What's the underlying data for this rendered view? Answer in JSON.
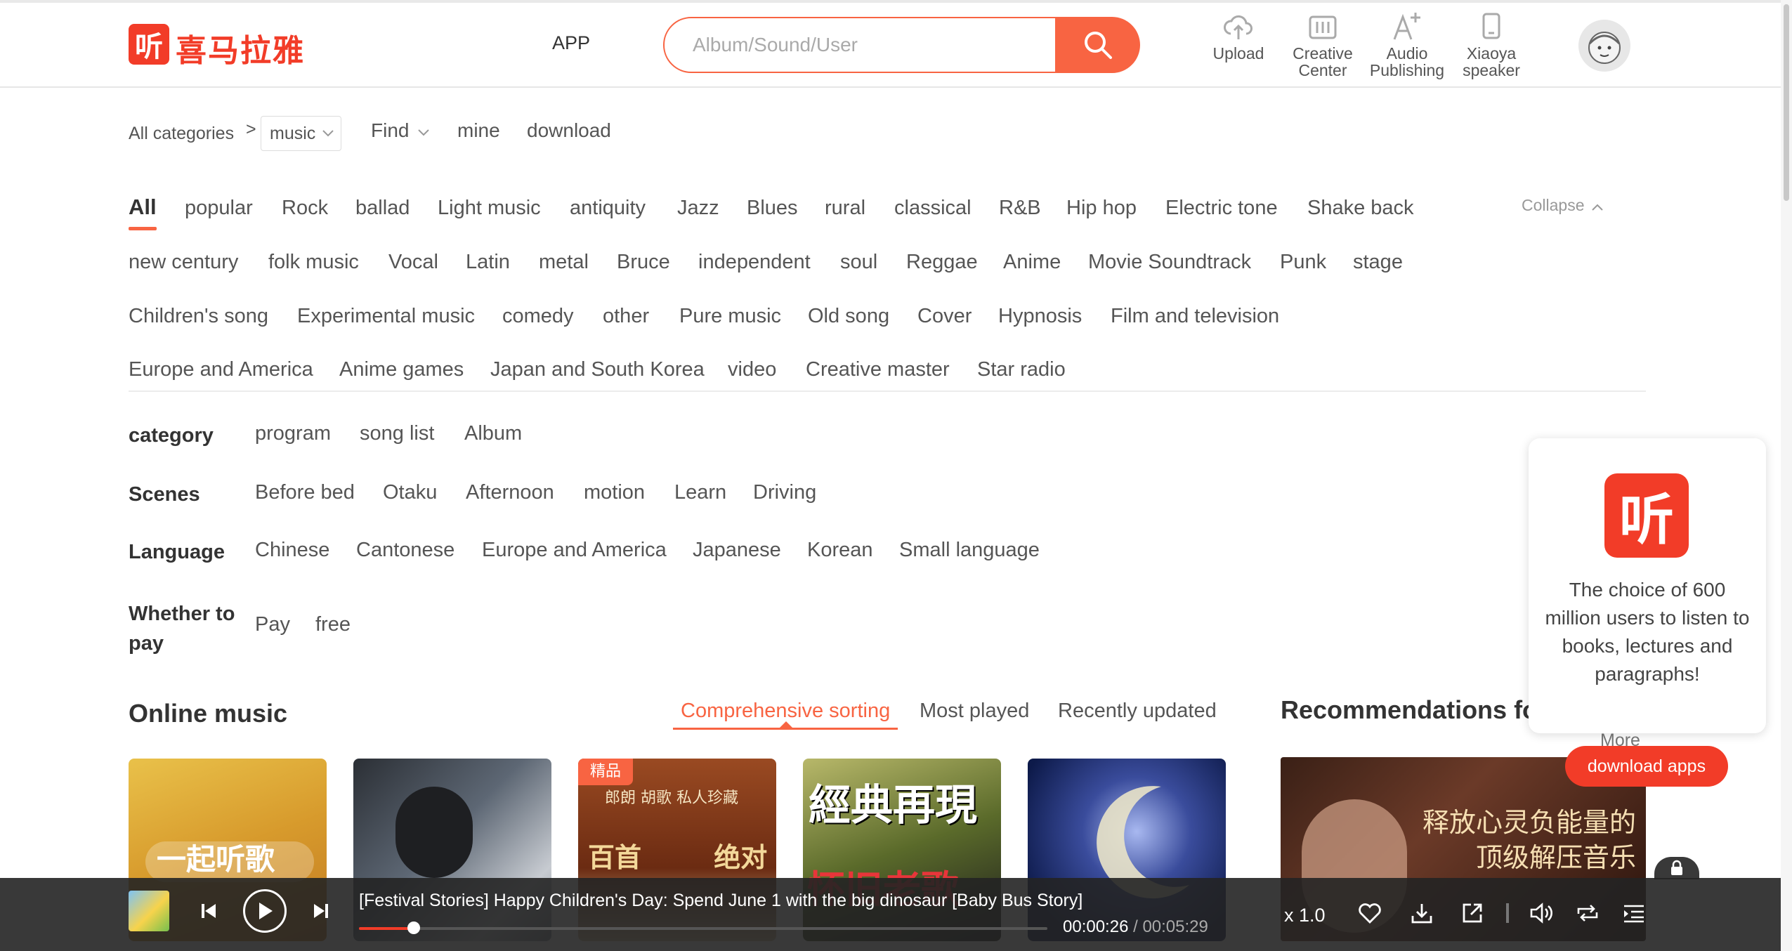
{
  "header": {
    "logo_glyph": "听",
    "logo_text": "喜马拉雅",
    "app_link": "APP",
    "search_placeholder": "Album/Sound/User",
    "tools": [
      {
        "label": "Upload",
        "icon": "cloud-upload-icon"
      },
      {
        "label": "Creative Center",
        "icon": "sliders-icon"
      },
      {
        "label": "Audio Publishing",
        "icon": "text-add-icon"
      },
      {
        "label": "Xiaoya speaker",
        "icon": "speaker-device-icon"
      }
    ]
  },
  "breadcrumb": {
    "root": "All categories",
    "separator": ">",
    "selected": "music",
    "nav": [
      "Find",
      "mine",
      "download"
    ]
  },
  "genres": {
    "row1": [
      "All",
      "popular",
      "Rock",
      "ballad",
      "Light music",
      "antiquity",
      "Jazz",
      "Blues",
      "rural",
      "classical",
      "R&B",
      "Hip hop",
      "Electric tone",
      "Shake back"
    ],
    "row2": [
      "new century",
      "folk music",
      "Vocal",
      "Latin",
      "metal",
      "Bruce",
      "independent",
      "soul",
      "Reggae",
      "Anime",
      "Movie Soundtrack",
      "Punk",
      "stage"
    ],
    "row3": [
      "Children's song",
      "Experimental music",
      "comedy",
      "other",
      "Pure music",
      "Old song",
      "Cover",
      "Hypnosis",
      "Film and television"
    ],
    "row4": [
      "Europe and America",
      "Anime games",
      "Japan and South Korea",
      "video",
      "Creative master",
      "Star radio"
    ],
    "collapse": "Collapse"
  },
  "filters": {
    "category": {
      "label": "category",
      "options": [
        "program",
        "song list",
        "Album"
      ]
    },
    "scenes": {
      "label": "Scenes",
      "options": [
        "Before bed",
        "Otaku",
        "Afternoon",
        "motion",
        "Learn",
        "Driving"
      ]
    },
    "language": {
      "label": "Language",
      "options": [
        "Chinese",
        "Cantonese",
        "Europe and America",
        "Japanese",
        "Korean",
        "Small language"
      ]
    },
    "pay": {
      "label_line1": "Whether to",
      "label_line2": "pay",
      "options": [
        "Pay",
        "free"
      ]
    }
  },
  "online_music": {
    "title": "Online music",
    "sort_tabs": [
      "Comprehensive sorting",
      "Most played",
      "Recently updated"
    ],
    "cards": [
      {
        "cover_text": "一起听歌",
        "badge": ""
      },
      {
        "cover_text": "",
        "badge": ""
      },
      {
        "cover_text": "百首 绝对",
        "badge": "精品",
        "top_text": "郎朗 胡歌 私人珍藏"
      },
      {
        "cover_text": "經典再現",
        "badge": "",
        "sub_text": "怀旧老歌"
      },
      {
        "cover_text": "",
        "badge": ""
      }
    ]
  },
  "recommendations": {
    "title": "Recommendations fo",
    "more": "More",
    "card_text": "释放心灵负能量的 顶级解压音乐"
  },
  "popup": {
    "logo_glyph": "听",
    "text": "The choice of 600 million users to listen to books, lectures and paragraphs!",
    "button": "download apps"
  },
  "player": {
    "title": "[Festival Stories] Happy Children's Day: Spend June 1 with the big dinosaur [Baby Bus Story]",
    "current_time": "00:00:26",
    "separator": " / ",
    "duration": "00:05:29",
    "progress": 0.08,
    "speed": "x 1.0"
  },
  "colors": {
    "accent": "#f86442",
    "brand_red": "#f23c28"
  }
}
